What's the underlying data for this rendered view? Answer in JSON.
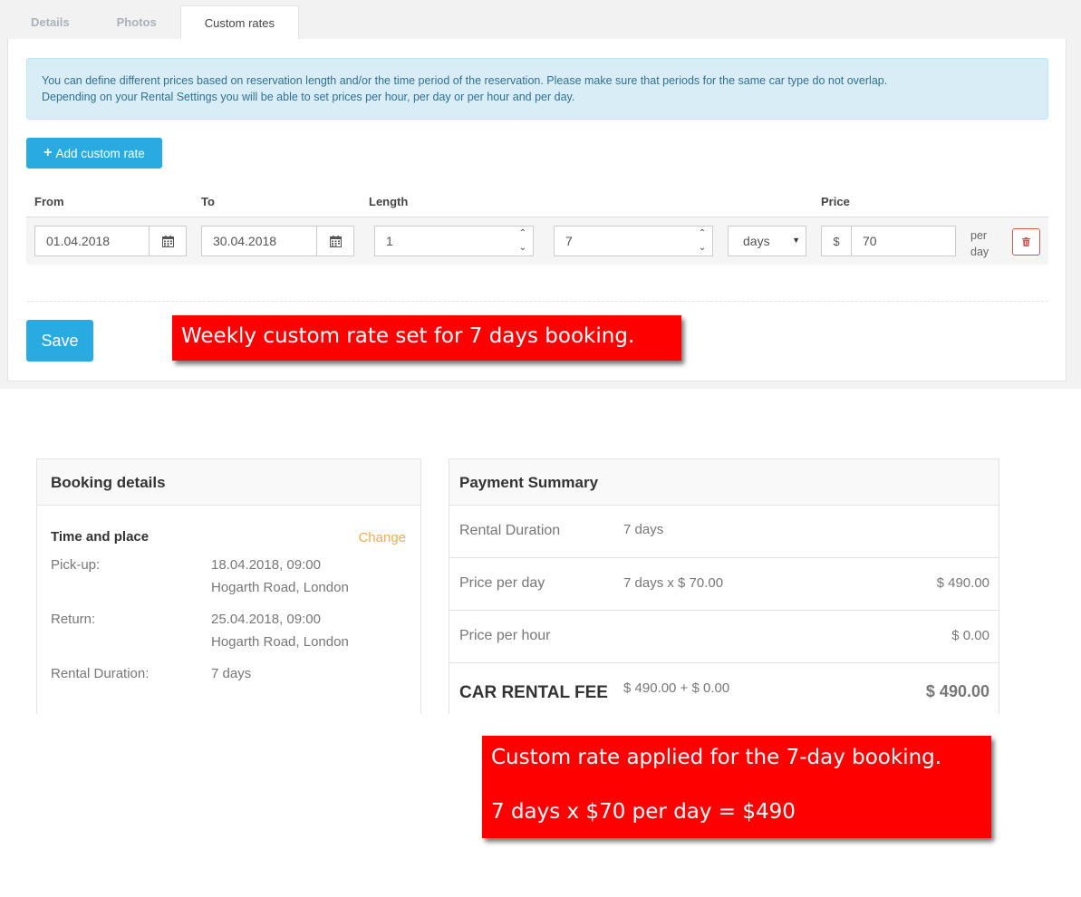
{
  "tabs": [
    {
      "label": "Details"
    },
    {
      "label": "Photos"
    },
    {
      "label": "Custom rates"
    }
  ],
  "info_text_1": "You can define different prices based on reservation length and/or the time period of the reservation. Please make sure that periods for the same car type do not overlap.",
  "info_text_2": "Depending on your Rental Settings you will be able to set prices per hour, per day or per hour and per day.",
  "add_button": {
    "icon": "plus-icon",
    "label": "Add custom rate"
  },
  "columns": {
    "from": "From",
    "to": "To",
    "length": "Length",
    "price": "Price"
  },
  "rate_row": {
    "from": "01.04.2018",
    "to": "30.04.2018",
    "length_min": "1",
    "length_max": "7",
    "unit": "days",
    "currency": "$",
    "price": "70",
    "per_1": "per",
    "per_2": "day"
  },
  "save_label": "Save",
  "callout_1": "Weekly custom rate set for 7 days booking.",
  "callout_2_line1": "Custom rate applied for the 7-day booking.",
  "callout_2_line2": "7 days x $70 per day = $490",
  "booking": {
    "title": "Booking details",
    "section": "Time and place",
    "change": "Change",
    "pickup_label": "Pick-up:",
    "pickup_time": "18.04.2018, 09:00",
    "pickup_place": "Hogarth Road, London",
    "return_label": "Return:",
    "return_time": "25.04.2018, 09:00",
    "return_place": "Hogarth Road, London",
    "duration_label": "Rental Duration:",
    "duration_value": "7 days"
  },
  "payment": {
    "title": "Payment Summary",
    "duration_label": "Rental Duration",
    "duration_value": "7 days",
    "per_day_label": "Price per day",
    "per_day_calc": "7 days x $ 70.00",
    "per_day_amount": "$ 490.00",
    "per_hour_label": "Price per hour",
    "per_hour_amount": "$ 0.00",
    "fee_label": "CAR RENTAL FEE",
    "fee_calc": "$ 490.00 + $ 0.00",
    "fee_amount": "$ 490.00"
  },
  "colors": {
    "accent": "#29abe2",
    "callout": "#ff0000",
    "info_bg": "#d9edf7",
    "change": "#f0ad4e"
  }
}
